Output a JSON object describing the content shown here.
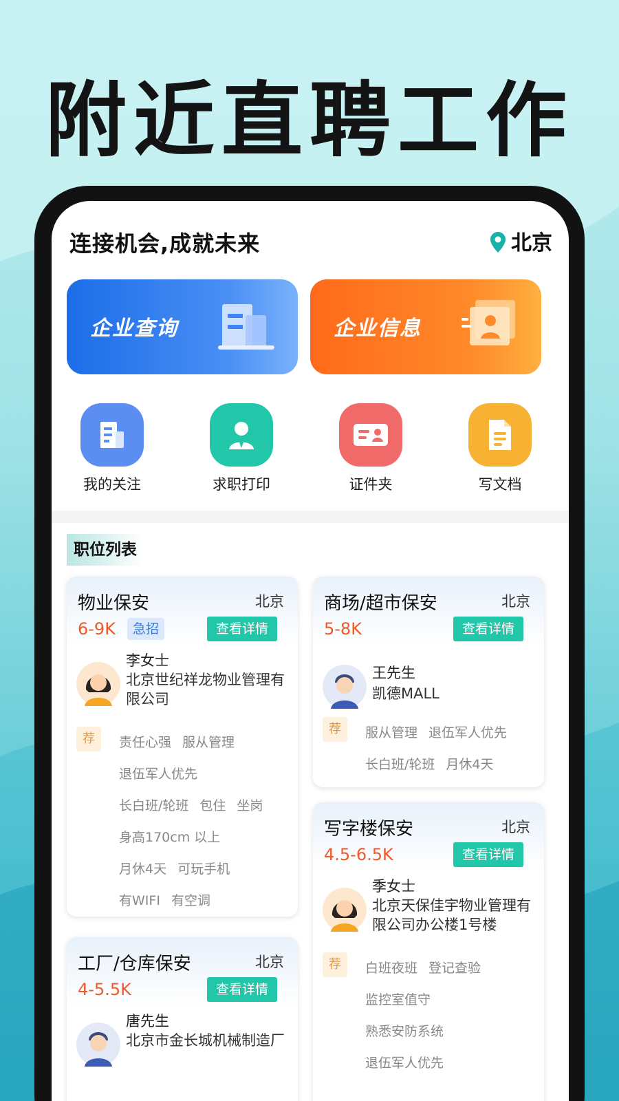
{
  "promo": {
    "title": "附近直聘工作"
  },
  "header": {
    "slogan": "连接机会,成就未来",
    "location": "北京",
    "location_icon": "map-pin-icon",
    "accent": "#17b3a8"
  },
  "banners": [
    {
      "label": "企业查询",
      "icon": "building-icon",
      "color": "#1c6de8"
    },
    {
      "label": "企业信息",
      "icon": "profile-card-icon",
      "color": "#ff6a1a"
    }
  ],
  "quick_actions": [
    {
      "label": "我的关注",
      "icon": "building-icon",
      "color": "#5b8ef0"
    },
    {
      "label": "求职打印",
      "icon": "person-tie-icon",
      "color": "#21c7a8"
    },
    {
      "label": "证件夹",
      "icon": "id-card-icon",
      "color": "#f06a6a"
    },
    {
      "label": "写文档",
      "icon": "document-icon",
      "color": "#f7b234"
    }
  ],
  "section": {
    "title": "职位列表"
  },
  "common": {
    "detail_label": "查看详情",
    "recommend_label": "荐"
  },
  "jobs": [
    {
      "title": "物业保安",
      "city": "北京",
      "salary": "6-9K",
      "urgent": "急招",
      "contact": "李女士",
      "company": "北京世纪祥龙物业管理有限公司",
      "avatar": "female",
      "tags": [
        [
          "责任心强",
          "服从管理"
        ],
        [
          "退伍军人优先"
        ],
        [
          "长白班/轮班",
          "包住",
          "坐岗"
        ],
        [
          "身高170cm 以上"
        ],
        [
          "月休4天",
          "可玩手机"
        ],
        [
          "有WIFI",
          "有空调"
        ]
      ]
    },
    {
      "title": "商场/超市保安",
      "city": "北京",
      "salary": "5-8K",
      "contact": "王先生",
      "company": "凯德MALL",
      "avatar": "male",
      "tags": [
        [
          "服从管理",
          "退伍军人优先"
        ],
        [
          "长白班/轮班",
          "月休4天"
        ]
      ]
    },
    {
      "title": "写字楼保安",
      "city": "北京",
      "salary": "4.5-6.5K",
      "contact": "季女士",
      "company": "北京天保佳宇物业管理有限公司办公楼1号楼",
      "avatar": "female",
      "tags": [
        [
          "白班夜班",
          "登记查验"
        ],
        [
          "监控室值守"
        ],
        [
          "熟悉安防系统"
        ],
        [
          "退伍军人优先"
        ]
      ]
    },
    {
      "title": "工厂/仓库保安",
      "city": "北京",
      "salary": "4-5.5K",
      "contact": "唐先生",
      "company": "北京市金长城机械制造厂",
      "avatar": "male",
      "tags": []
    }
  ]
}
